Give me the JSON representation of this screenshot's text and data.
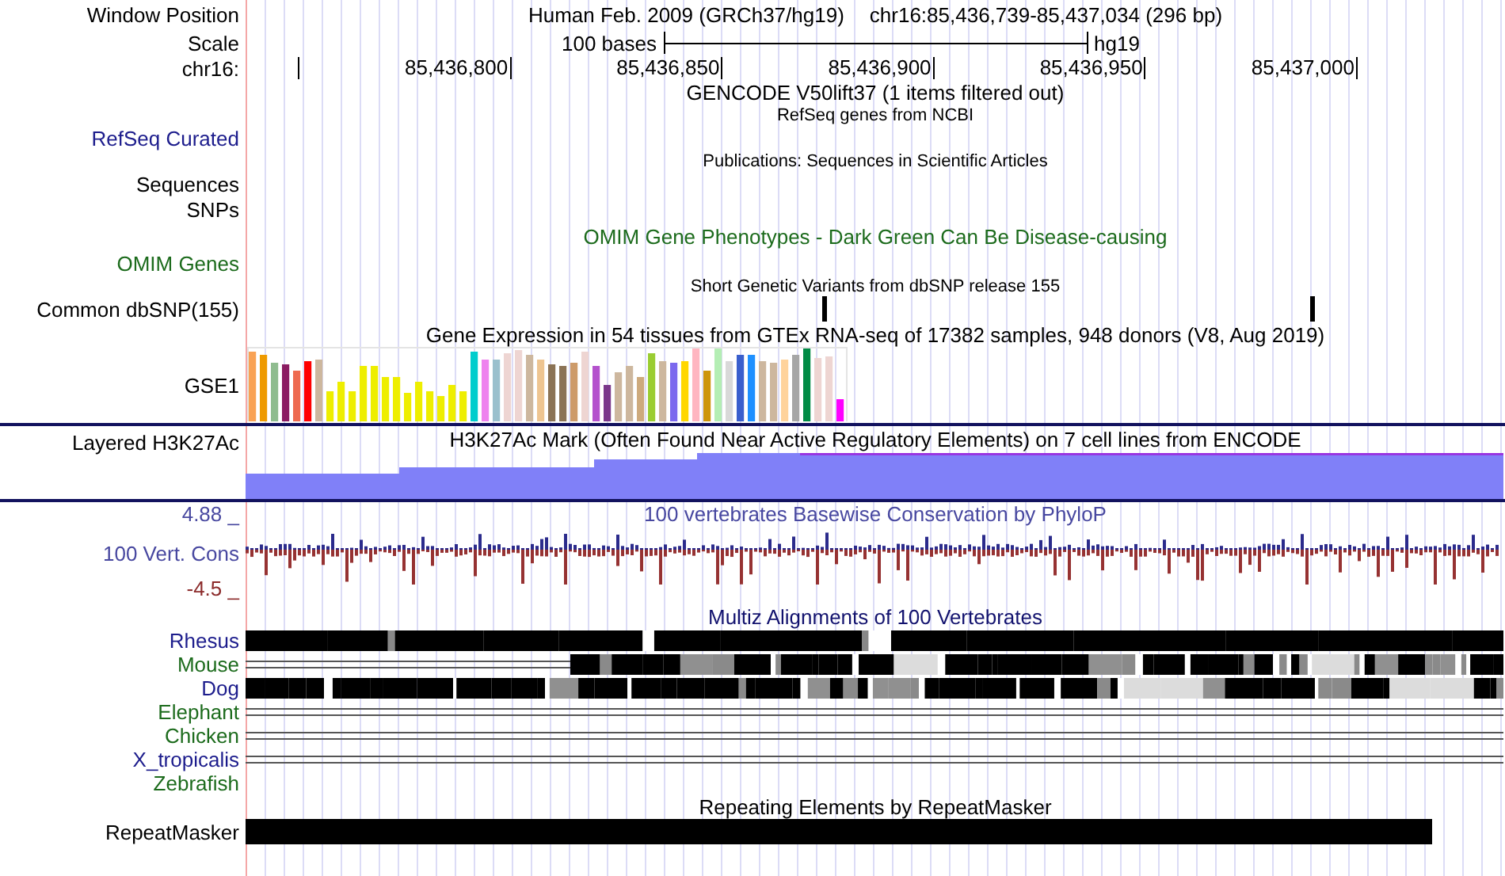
{
  "header": {
    "label": "Window Position",
    "assembly": "Human Feb. 2009 (GRCh37/hg19)",
    "position": "chr16:85,436,739-85,437,034 (296 bp)"
  },
  "scale": {
    "label": "Scale",
    "length": "100 bases",
    "assembly": "hg19"
  },
  "ruler": {
    "label": "chr16:",
    "ticks": [
      "85,436,800",
      "85,436,850",
      "85,436,900",
      "85,436,950",
      "85,437,000"
    ]
  },
  "tracks": [
    {
      "kind": "header",
      "title": "GENCODE V50lift37 (1 items filtered out)"
    },
    {
      "kind": "compact",
      "title": "RefSeq genes from NCBI",
      "label": "RefSeq Curated",
      "color": "#1c1c8c"
    },
    {
      "kind": "compact",
      "title": "Publications: Sequences in Scientific Articles"
    },
    {
      "kind": "label",
      "label": "Sequences",
      "color": "#000000"
    },
    {
      "kind": "label",
      "label": "SNPs",
      "color": "#000000"
    },
    {
      "kind": "track",
      "title": "OMIM Gene Phenotypes - Dark Green Can Be Disease-causing",
      "label": "OMIM Genes",
      "color": "#1c6b1c"
    },
    {
      "kind": "snp",
      "title": "Short Genetic Variants from dbSNP release 155",
      "label": "Common dbSNP(155)",
      "color": "#000000"
    },
    {
      "kind": "expression",
      "title": "Gene Expression in 54 tissues from GTEx RNA-seq of 17382 samples, 948 donors (V8, Aug 2019)",
      "label": "GSE1",
      "color": "#000000"
    },
    {
      "kind": "signal",
      "title": "H3K27Ac Mark (Often Found Near Active Regulatory Elements) on 7 cell lines from ENCODE",
      "label": "Layered H3K27Ac",
      "color": "#000000"
    },
    {
      "kind": "conservation",
      "title": "100 vertebrates Basewise Conservation by PhyloP",
      "label": "100 Vert. Cons",
      "color": "#4848a0",
      "max": "4.88 _",
      "min": "-4.5 _"
    },
    {
      "kind": "alignment",
      "title": "Multiz Alignments of 100 Vertebrates",
      "species": [
        {
          "label": "Rhesus",
          "color": "#1c1c8c",
          "kind": "aligned"
        },
        {
          "label": "Mouse",
          "color": "#1c6b1c",
          "kind": "partial"
        },
        {
          "label": "Dog",
          "color": "#1c1c8c",
          "kind": "fragmented"
        },
        {
          "label": "Elephant",
          "color": "#1c6b1c",
          "kind": "lines"
        },
        {
          "label": "Chicken",
          "color": "#1c6b1c",
          "kind": "lines"
        },
        {
          "label": "X_tropicalis",
          "color": "#1c1c8c",
          "kind": "lines"
        },
        {
          "label": "Zebrafish",
          "color": "#1c6b1c",
          "kind": "blank"
        }
      ]
    },
    {
      "kind": "repeat",
      "title": "Repeating Elements by RepeatMasker",
      "label": "RepeatMasker",
      "color": "#000000"
    }
  ]
}
